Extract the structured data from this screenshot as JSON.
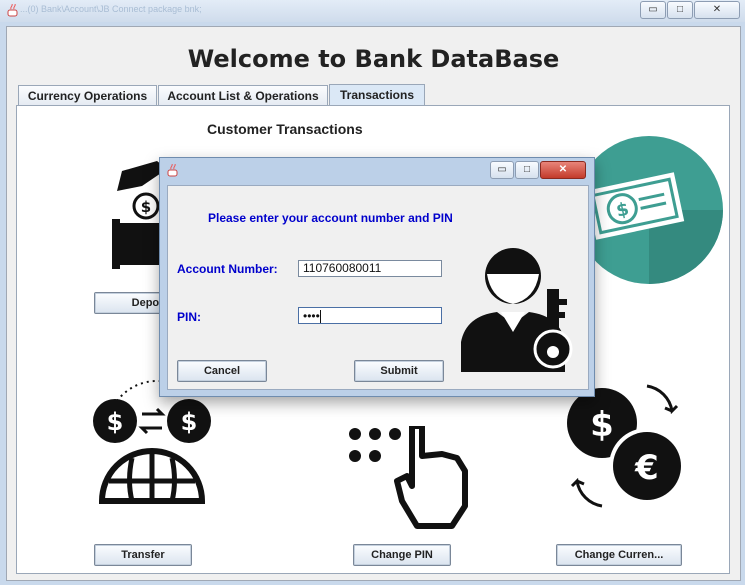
{
  "window": {
    "title_background_text": "...(0) Bank\\Account\\JB Connect          package bnk;",
    "min_label": "▭",
    "max_label": "□",
    "close_label": "✕"
  },
  "app": {
    "heading": "Welcome to Bank DataBase"
  },
  "tabs": [
    {
      "label": "Currency Operations"
    },
    {
      "label": "Account List & Operations"
    },
    {
      "label": "Transactions",
      "active": true
    }
  ],
  "panel": {
    "title": "Customer Transactions",
    "buttons": {
      "deposit": "Deposi",
      "transfer": "Transfer",
      "change_pin": "Change PIN",
      "change_currency": "Change Curren..."
    }
  },
  "dialog": {
    "prompt": "Please enter your account number and PIN",
    "account_label": "Account Number:",
    "account_value": "110760080011",
    "pin_label": "PIN:",
    "pin_value": "••••",
    "cancel_label": "Cancel",
    "submit_label": "Submit"
  },
  "colors": {
    "prompt_blue": "#0000cc",
    "teal_circle": "#3e9e92",
    "icon_black": "#111111"
  }
}
